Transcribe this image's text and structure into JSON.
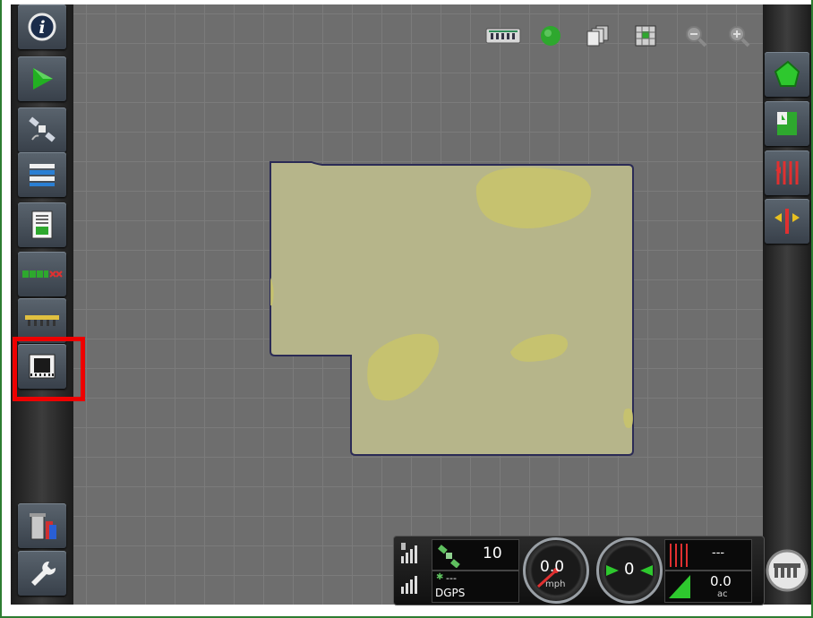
{
  "left_toolbar": {
    "buttons": [
      {
        "name": "info-button",
        "icon": "info-icon"
      },
      {
        "name": "guidance-button",
        "icon": "play-arrow-icon"
      },
      {
        "name": "gps-button",
        "icon": "satellite-icon"
      },
      {
        "name": "layers-button",
        "icon": "bars-list-icon"
      },
      {
        "name": "report-button",
        "icon": "document-icon"
      },
      {
        "name": "section-control-button",
        "icon": "sections-icon"
      },
      {
        "name": "implement-button",
        "icon": "implement-icon"
      },
      {
        "name": "video-button",
        "icon": "video-film-icon",
        "highlighted": true
      },
      {
        "name": "trash-button",
        "icon": "trash-icon"
      },
      {
        "name": "settings-button",
        "icon": "wrench-icon"
      }
    ]
  },
  "top_toolbar": {
    "icons": [
      "implement-icon",
      "status-led-icon",
      "pages-icon",
      "grid-view-icon",
      "zoom-out-icon",
      "zoom-in-icon"
    ]
  },
  "right_toolbar": {
    "buttons": [
      {
        "name": "field-button",
        "icon": "field-icon"
      },
      {
        "name": "boundary-button",
        "icon": "field-boundary-icon"
      },
      {
        "name": "rows-button",
        "icon": "rows-icon"
      },
      {
        "name": "shift-button",
        "icon": "shift-arrows-icon"
      }
    ]
  },
  "status_bar": {
    "satellite_count": "10",
    "correction_value": "---",
    "gps_mode": "DGPS",
    "speed_value": "0.0",
    "speed_unit": "mph",
    "heading_value": "0",
    "rate_value": "---",
    "area_value": "0.0",
    "area_unit": "ac"
  },
  "colors": {
    "map_background": "#6e6e6e",
    "field_fill": "#b6b58a",
    "coverage_patch": "#c9c46a",
    "highlight": "#ee0000",
    "frame": "#2e7d32",
    "led_green": "#2ea82e"
  }
}
